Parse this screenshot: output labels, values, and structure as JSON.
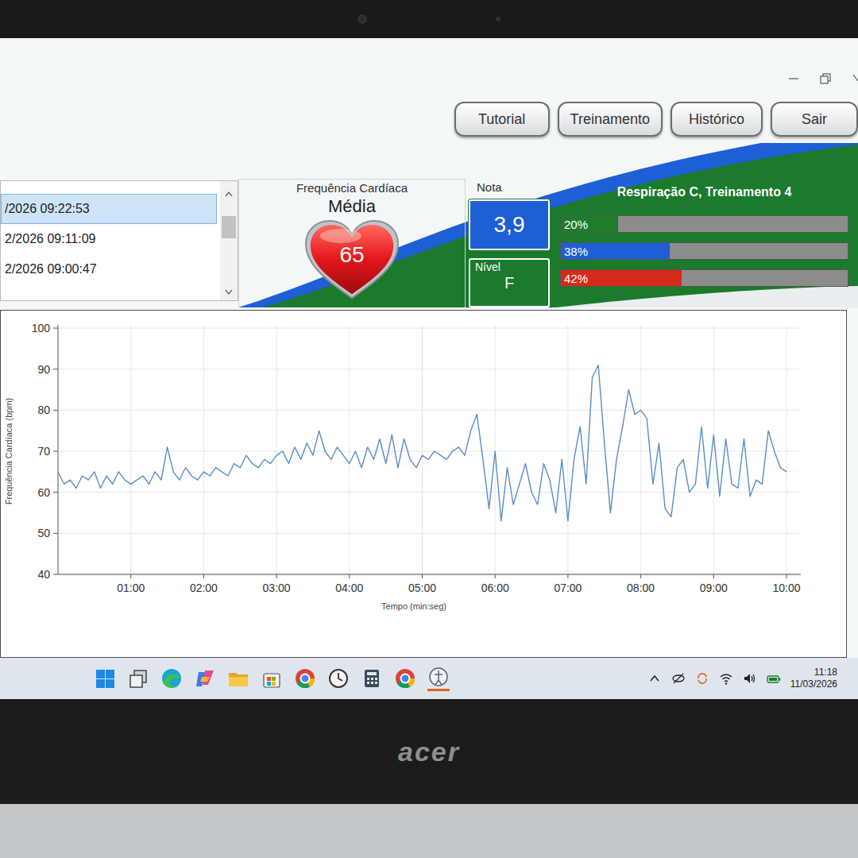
{
  "toolbar": {
    "buttons": [
      {
        "label": "Tutorial"
      },
      {
        "label": "Treinamento"
      },
      {
        "label": "Histórico"
      },
      {
        "label": "Sair"
      }
    ]
  },
  "sessions": [
    {
      "label": "/2026 09:22:53",
      "selected": true
    },
    {
      "label": "2/2026 09:11:09",
      "selected": false
    },
    {
      "label": "2/2026 09:00:47",
      "selected": false
    }
  ],
  "heart_rate": {
    "label": "Frequência Cardíaca",
    "subtitle": "Média",
    "value": "65"
  },
  "score": {
    "label": "Nota",
    "value": "3,9",
    "level_label": "Nível",
    "level_value": "F"
  },
  "summary": {
    "title": "Respiração C, Treinamento 4",
    "bars": [
      {
        "reading": "20%",
        "level": 0.2,
        "color": "#1e7d2c"
      },
      {
        "reading": "38%",
        "level": 0.38,
        "color": "#1f5fd6"
      },
      {
        "reading": "42%",
        "level": 0.42,
        "color": "#d42a1a"
      }
    ]
  },
  "chart": {
    "y_label": "Frequência Cardíaca (bpm)",
    "x_label": "Tempo (min:seg)",
    "y_ticks": [
      "100",
      "90",
      "80",
      "70",
      "60",
      "50",
      "40"
    ],
    "x_ticks": [
      "01:00",
      "02:00",
      "03:00",
      "04:00",
      "05:00",
      "06:00",
      "07:00",
      "08:00",
      "09:00",
      "10:00"
    ],
    "series": [
      {
        "values": [
          65,
          62,
          63,
          61,
          64,
          63,
          65,
          61,
          64,
          62,
          65,
          63,
          62,
          63,
          64,
          62,
          65,
          63,
          71,
          65,
          63,
          66,
          64,
          63,
          65,
          64,
          66,
          65,
          64,
          67,
          66,
          69,
          67,
          66,
          68,
          67,
          69,
          70,
          67,
          71,
          68,
          72,
          69,
          75,
          70,
          68,
          71,
          69,
          67,
          70,
          66,
          71,
          68,
          73,
          67,
          74,
          66,
          73,
          68,
          66,
          69,
          68,
          70,
          69,
          68,
          70,
          71,
          69,
          75,
          79,
          68,
          56,
          70,
          53,
          66,
          57,
          62,
          67,
          60,
          57,
          67,
          63,
          55,
          68,
          53,
          68,
          76,
          62,
          88,
          91,
          72,
          55,
          68,
          76,
          85,
          79,
          80,
          78,
          62,
          72,
          56,
          54,
          66,
          68,
          60,
          62,
          76,
          61,
          74,
          59,
          73,
          62,
          61,
          73,
          59,
          63,
          62,
          75,
          70,
          66,
          65
        ]
      }
    ]
  },
  "taskbar": {
    "time": "11:18",
    "date": "11/03/2026"
  },
  "bezel": {
    "brand": "acer"
  }
}
